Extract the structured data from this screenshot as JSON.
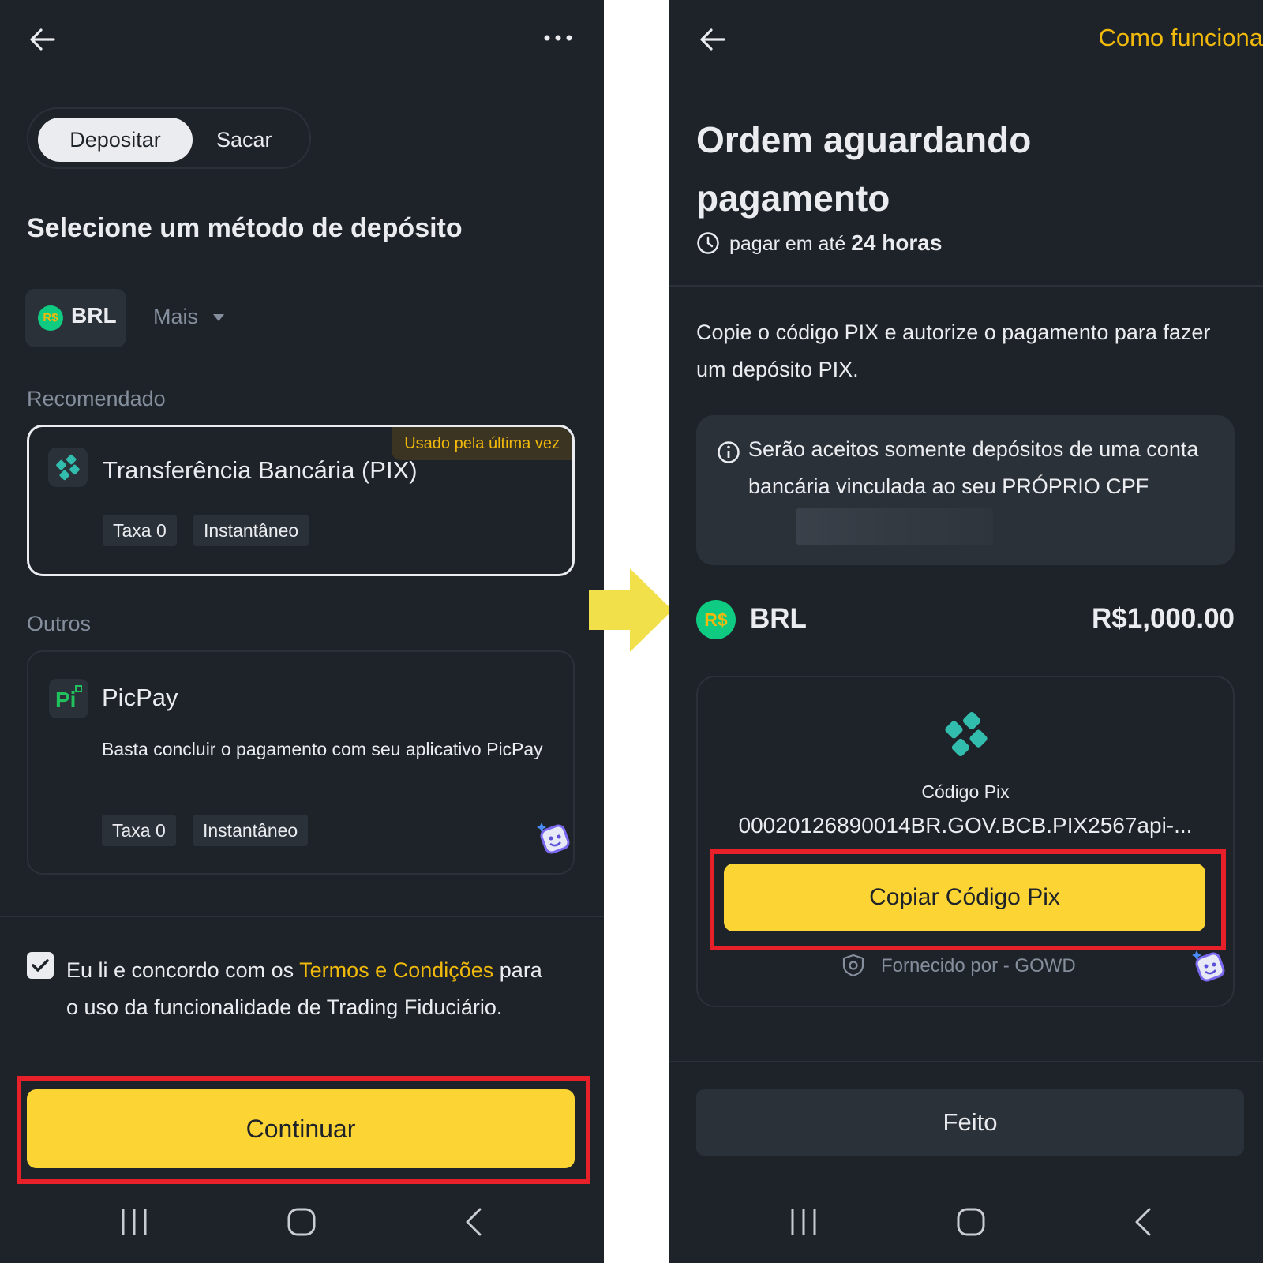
{
  "left": {
    "tabs": {
      "deposit": "Depositar",
      "withdraw": "Sacar"
    },
    "heading": "Selecione um método de depósito",
    "currency": {
      "badge": "R$",
      "code": "BRL"
    },
    "more_label": "Mais",
    "recommended_label": "Recomendado",
    "pix_card": {
      "badge": "Usado pela última vez",
      "title": "Transferência Bancária (PIX)",
      "tags": [
        "Taxa 0",
        "Instantâneo"
      ]
    },
    "others_label": "Outros",
    "picpay_card": {
      "title": "PicPay",
      "description": "Basta concluir o pagamento com seu aplicativo PicPay",
      "tags": [
        "Taxa 0",
        "Instantâneo"
      ]
    },
    "terms": {
      "prefix": "Eu li e concordo com os ",
      "link": "Termos e Condições",
      "suffix": " para o uso da funcionalidade de Trading Fiduciário."
    },
    "continue_button": "Continuar"
  },
  "right": {
    "help_link": "Como funciona",
    "title": "Ordem aguardando pagamento",
    "deadline": {
      "prefix": "pagar em até ",
      "value": "24 horas"
    },
    "instructions": "Copie o código PIX e autorize o pagamento para fazer um depósito PIX.",
    "notice": "Serão aceitos somente depósitos de uma conta bancária vinculada ao seu PRÓPRIO CPF",
    "currency": {
      "badge": "R$",
      "code": "BRL"
    },
    "amount": "R$1,000.00",
    "pix_label": "Código Pix",
    "pix_code": "00020126890014BR.GOV.BCB.PIX2567api-...",
    "copy_button": "Copiar Código Pix",
    "provider": "Fornecido por - GOWD",
    "done_button": "Feito"
  },
  "colors": {
    "background": "#1e2329",
    "accent": "#fcd535",
    "highlight": "#e8202a",
    "arrow": "#f2e04a"
  }
}
